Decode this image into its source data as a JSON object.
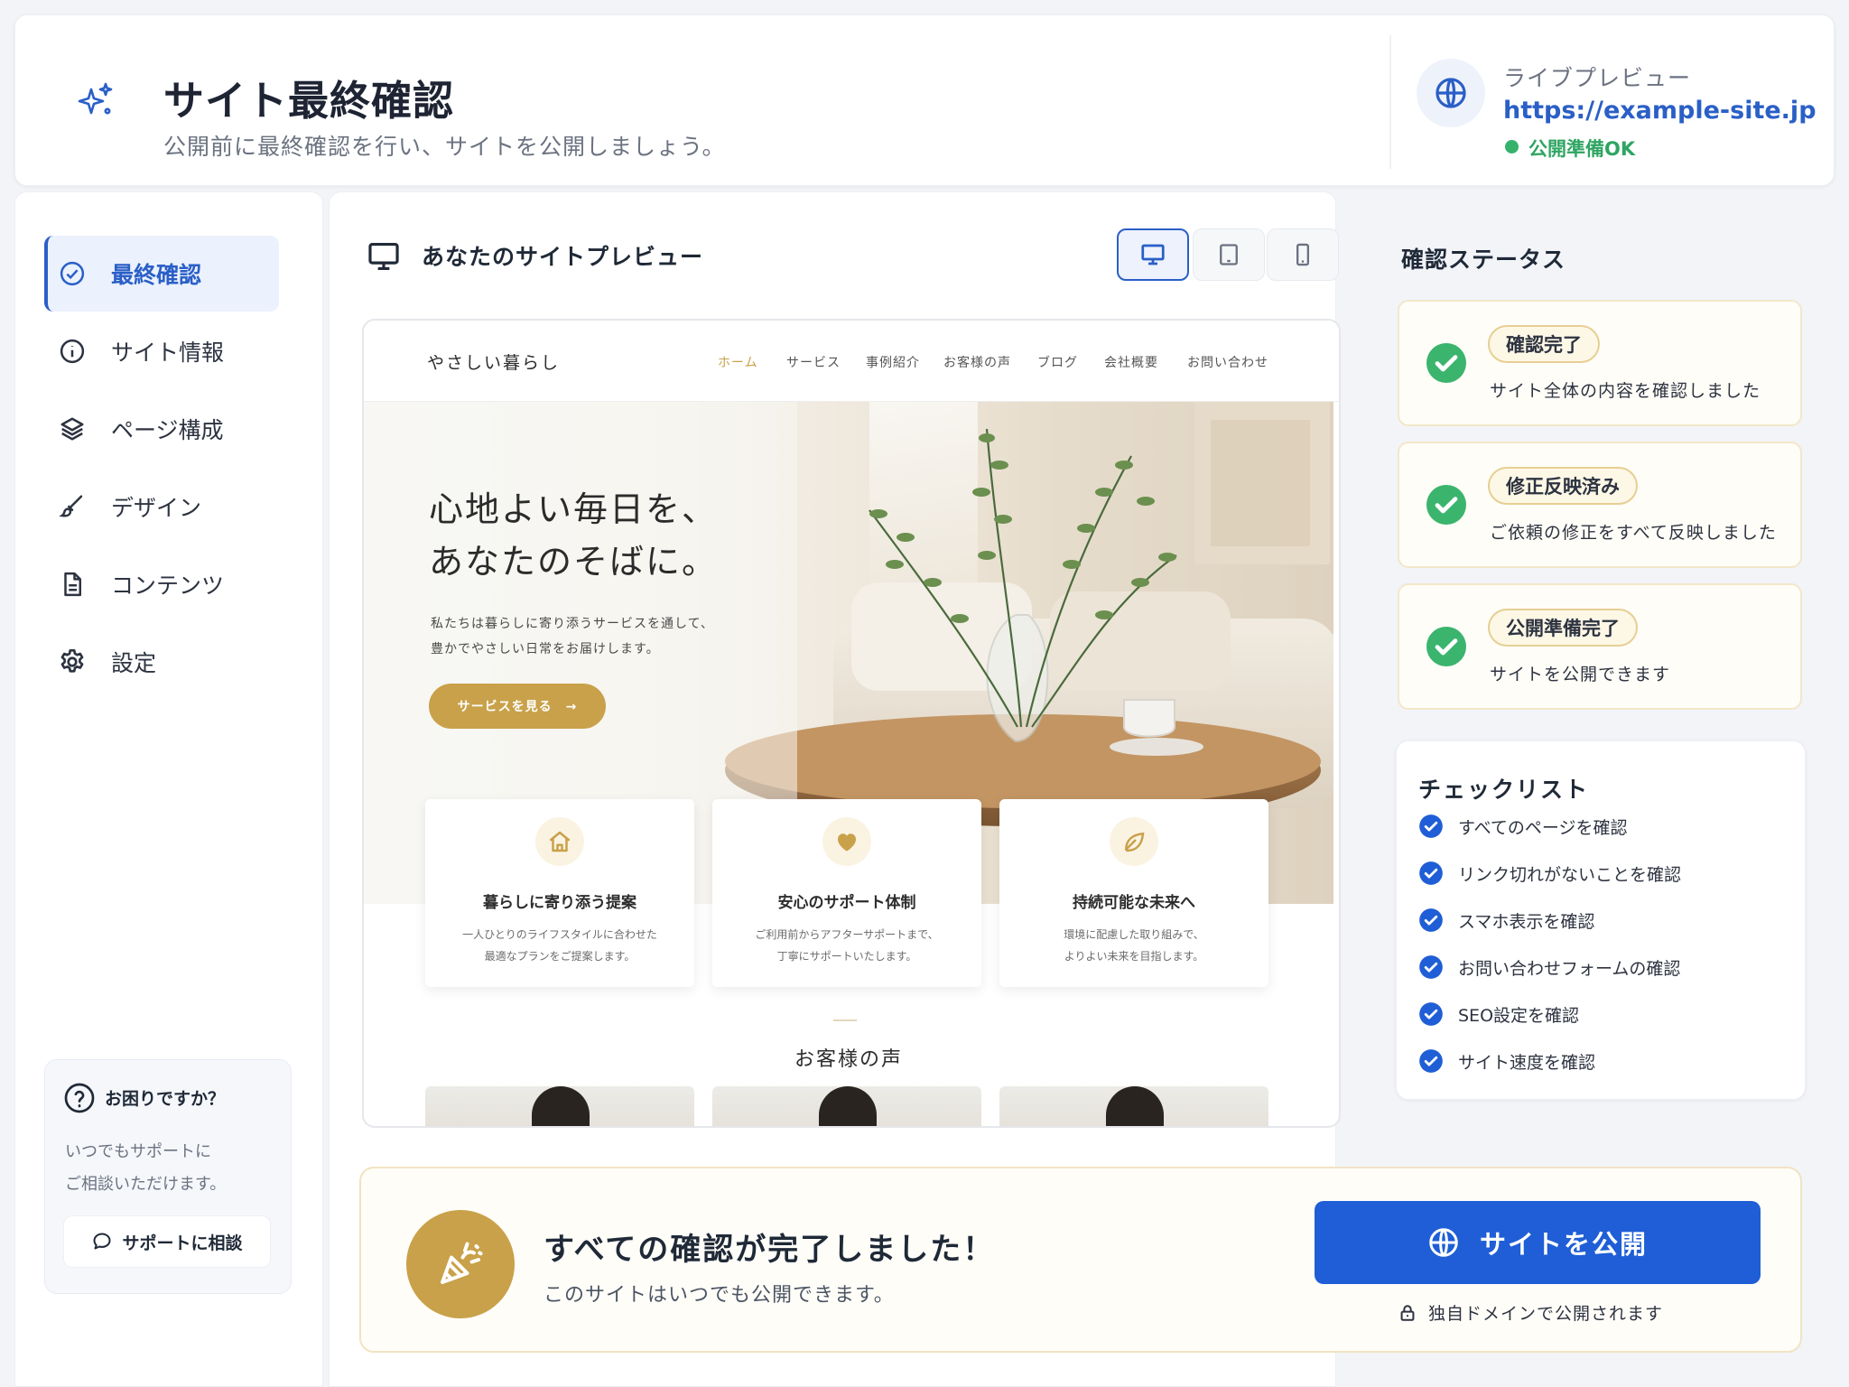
{
  "header": {
    "title": "サイト最終確認",
    "subtitle": "公開前に最終確認を行い、サイトを公開しましょう。",
    "live_preview_label": "ライブプレビュー",
    "live_preview_url": "https://example-site.jp",
    "status_text": "公開準備OK",
    "status_color": "#35b26b"
  },
  "sidebar": {
    "items": [
      {
        "label": "最終確認",
        "icon": "check-circle-icon",
        "active": true
      },
      {
        "label": "サイト情報",
        "icon": "info-icon"
      },
      {
        "label": "ページ構成",
        "icon": "layers-icon"
      },
      {
        "label": "デザイン",
        "icon": "brush-icon"
      },
      {
        "label": "コンテンツ",
        "icon": "document-icon"
      },
      {
        "label": "設定",
        "icon": "gear-icon"
      }
    ],
    "help": {
      "title": "お困りですか？",
      "description_line1": "いつでもサポートに",
      "description_line2": "ご相談いただけます。",
      "button_label": "サポートに相談"
    }
  },
  "main": {
    "title": "あなたのサイトプレビュー",
    "devices": [
      "desktop-icon",
      "tablet-icon",
      "mobile-icon"
    ],
    "active_device": "desktop"
  },
  "site_preview": {
    "logo": "やさしい暮らし",
    "nav": [
      "ホーム",
      "サービス",
      "事例紹介",
      "お客様の声",
      "ブログ",
      "会社概要",
      "お問い合わせ"
    ],
    "hero_line1": "心地よい毎日を、",
    "hero_line2": "あなたのそばに。",
    "hero_desc1": "私たちは暮らしに寄り添うサービスを通して、",
    "hero_desc2": "豊かでやさしい日常をお届けします。",
    "hero_button": "サービスを見る　→",
    "features": [
      {
        "icon": "home-icon",
        "title": "暮らしに寄り添う提案",
        "desc": "一人ひとりのライフスタイルに合わせた\n最適なプランをご提案します。"
      },
      {
        "icon": "heart-icon",
        "title": "安心のサポート体制",
        "desc": "ご利用前からアフターサポートまで、\n丁寧にサポートいたします。"
      },
      {
        "icon": "leaf-icon",
        "title": "持続可能な未来へ",
        "desc": "環境に配慮した取り組みで、\nよりよい未来を目指します。"
      }
    ],
    "voice_title": "お客様の声",
    "accent_color": "#c9a14a"
  },
  "status_panel": {
    "title": "確認ステータス",
    "items": [
      {
        "badge": "確認完了",
        "desc": "サイト全体の内容を確認しました"
      },
      {
        "badge": "修正反映済み",
        "desc": "ご依頼の修正をすべて反映しました"
      },
      {
        "badge": "公開準備完了",
        "desc": "サイトを公開できます"
      }
    ]
  },
  "checklist": {
    "title": "チェックリスト",
    "items": [
      "すべてのページを確認",
      "リンク切れがないことを確認",
      "スマホ表示を確認",
      "お問い合わせフォームの確認",
      "SEO設定を確認",
      "サイト速度を確認"
    ]
  },
  "publish": {
    "title": "すべての確認が完了しました！",
    "description": "このサイトはいつでも公開できます。",
    "button_label": "サイトを公開",
    "note": "独自ドメインで公開されます",
    "button_color": "#1f5ed6"
  }
}
